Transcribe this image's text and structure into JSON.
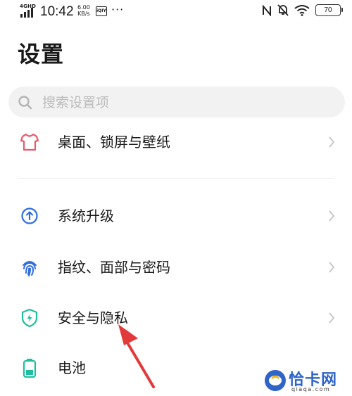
{
  "status_bar": {
    "network": "4GHD",
    "time": "10:42",
    "speed_value": "6.00",
    "speed_unit": "KB/s",
    "app_icon_text": "iQIY",
    "more": "···",
    "battery": "70"
  },
  "page": {
    "title": "设置"
  },
  "search": {
    "placeholder": "搜索设置项"
  },
  "items": [
    {
      "label": "桌面、锁屏与壁纸",
      "icon": "tshirt-icon",
      "color": "#e85a6a"
    },
    {
      "label": "系统升级",
      "icon": "upgrade-arrow-icon",
      "color": "#2f6de0"
    },
    {
      "label": "指纹、面部与密码",
      "icon": "fingerprint-icon",
      "color": "#2f6de0"
    },
    {
      "label": "安全与隐私",
      "icon": "shield-icon",
      "color": "#1bbf9f"
    },
    {
      "label": "电池",
      "icon": "battery-icon",
      "color": "#1bbf9f"
    }
  ],
  "annotation": {
    "color": "#e23a3a"
  },
  "watermark": {
    "brand": "恰卡网",
    "domain": "qiaqa.com"
  }
}
